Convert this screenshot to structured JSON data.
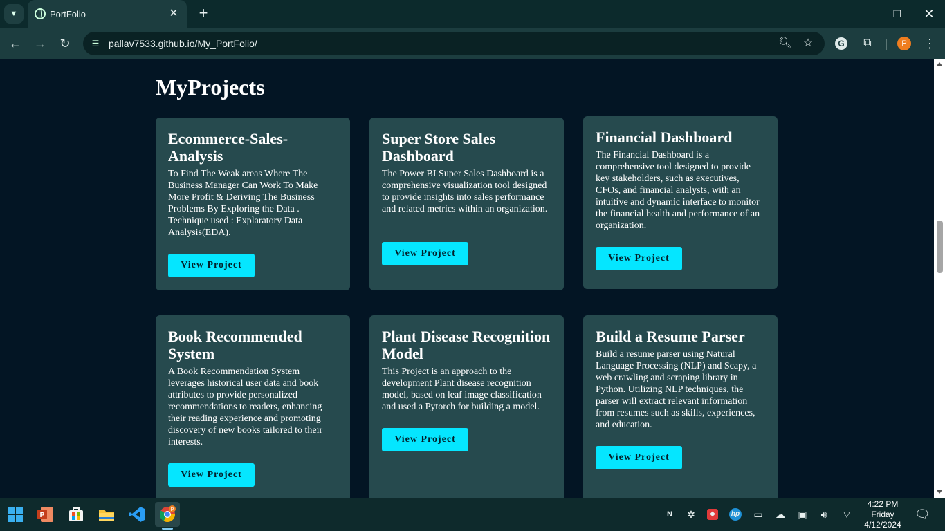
{
  "browser": {
    "tab_title": "PortFolio",
    "url": "pallav7533.github.io/My_PortFolio/",
    "profile_initial": "P",
    "icons": [
      "tab-search-icon",
      "globe-icon",
      "close-icon",
      "plus-icon",
      "back-icon",
      "forward-icon",
      "reload-icon",
      "site-info-icon",
      "zoom-icon",
      "star-icon",
      "grammarly-icon",
      "extensions-icon",
      "menu-icon"
    ]
  },
  "page": {
    "section_title": "MyProjects",
    "projects": [
      {
        "title": "Ecommerce-Sales-Analysis",
        "description": "To Find The Weak areas Where The Business Manager Can Work To Make More Profit & Deriving The Business Problems By Exploring the Data . Technique used : Explaratory Data Analysis(EDA).",
        "button": "View Project"
      },
      {
        "title": "Super Store Sales Dashboard",
        "description": "The Power BI Super Sales Dashboard is a comprehensive visualization tool designed to provide insights into sales performance and related metrics within an organization.",
        "button": "View Project"
      },
      {
        "title": "Financial Dashboard",
        "description": "The Financial Dashboard is a comprehensive tool designed to provide key stakeholders, such as executives, CFOs, and financial analysts, with an intuitive and dynamic interface to monitor the financial health and performance of an organization.",
        "button": "View Project"
      },
      {
        "title": "Book Recommended System",
        "description": "A Book Recommendation System leverages historical user data and book attributes to provide personalized recommendations to readers, enhancing their reading experience and promoting discovery of new books tailored to their interests.",
        "button": "View Project"
      },
      {
        "title": "Plant Disease Recognition Model",
        "description": "This Project is an approach to the development Plant disease recognition model, based on leaf image classification and used a Pytorch for building a model.",
        "button": "View Project"
      },
      {
        "title": "Build a Resume Parser",
        "description": "Build a resume parser using Natural Language Processing (NLP) and Scapy, a web crawling and scraping library in Python. Utilizing NLP techniques, the parser will extract relevant information from resumes such as skills, experiences, and education.",
        "button": "View Project"
      }
    ]
  },
  "taskbar": {
    "apps": [
      "windows-start-icon",
      "powerpoint-icon",
      "store-icon",
      "file-explorer-icon",
      "vscode-icon",
      "chrome-icon"
    ],
    "time": "4:22 PM",
    "day": "Friday",
    "date": "4/12/2024"
  },
  "colors": {
    "page_bg": "#031524",
    "card_bg": "#264a4e",
    "button_bg": "#05e6ff"
  }
}
